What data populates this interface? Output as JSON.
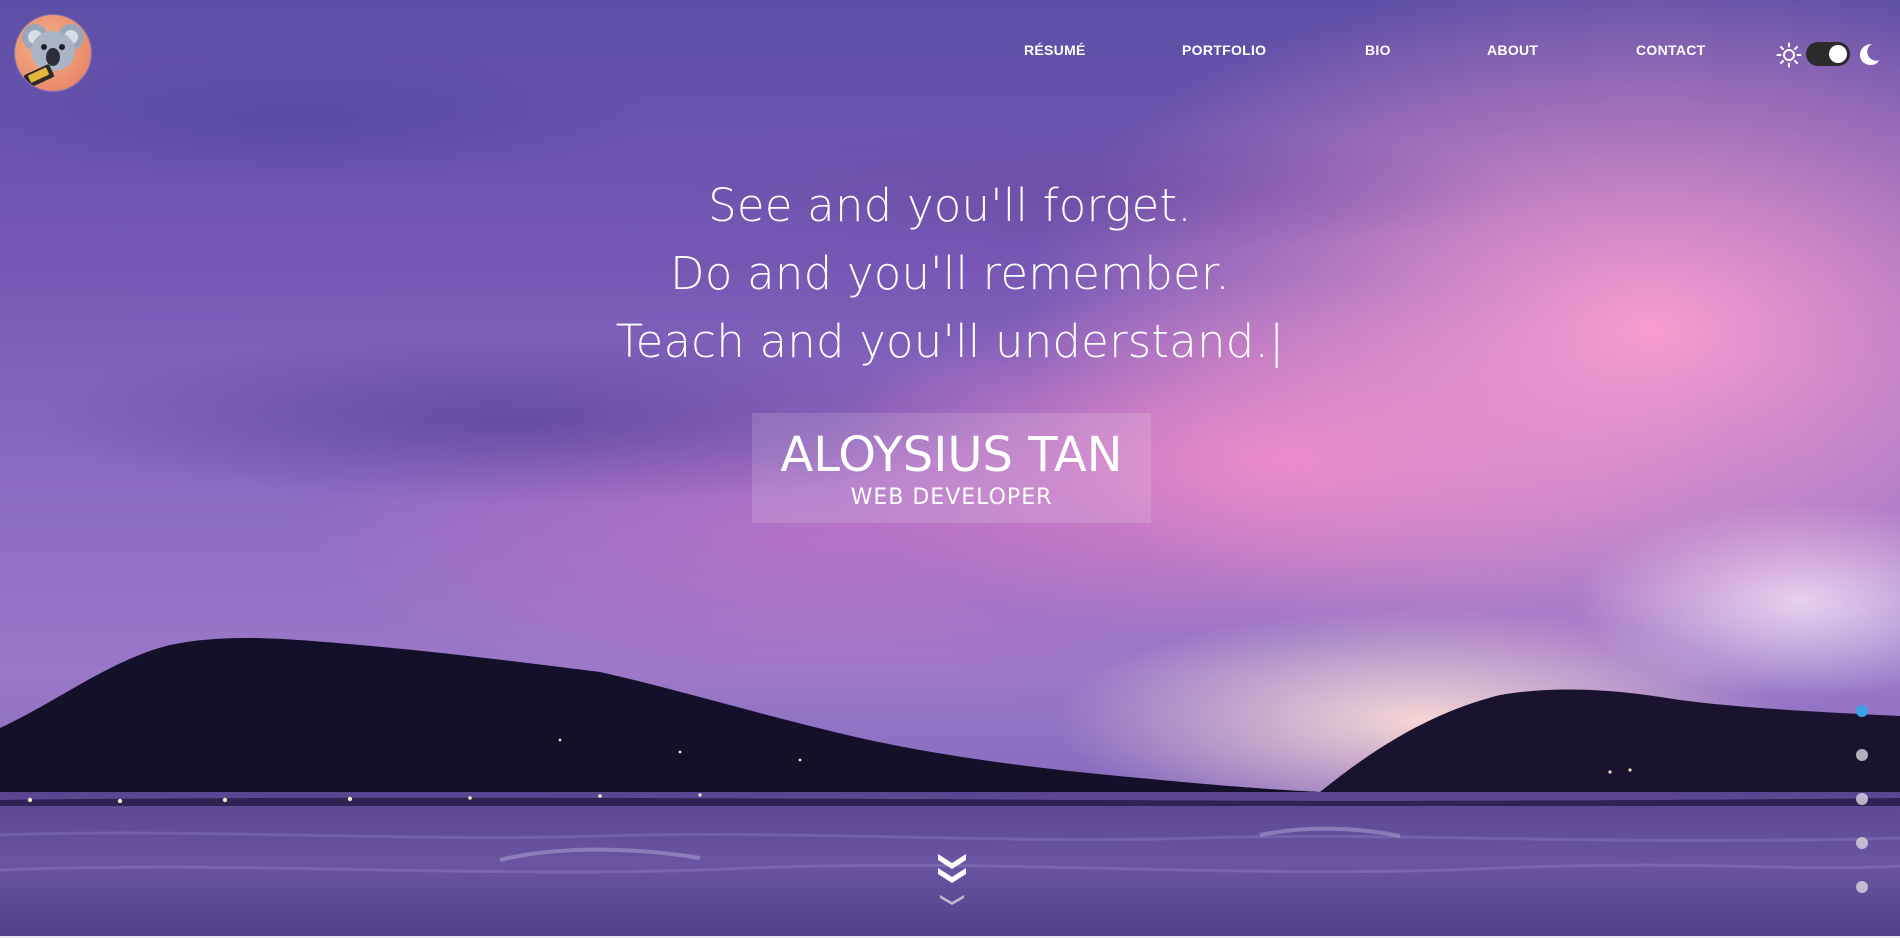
{
  "nav": {
    "items": [
      {
        "label": "RÉSUMÉ"
      },
      {
        "label": "PORTFOLIO"
      },
      {
        "label": "BIO"
      },
      {
        "label": "ABOUT"
      },
      {
        "label": "CONTACT"
      }
    ]
  },
  "theme_toggle": {
    "left_icon": "sun-icon",
    "right_icon": "moon-icon",
    "state": "dark"
  },
  "hero": {
    "quote_lines": [
      "See and you'll forget.",
      "Do and you'll remember.",
      "Teach and you'll understand."
    ],
    "cursor": "|",
    "name": "ALOYSIUS TAN",
    "title": "WEB DEVELOPER"
  },
  "scroll_indicator": {
    "icon": "double-chevron-down-icon"
  },
  "section_pager": {
    "count": 5,
    "active_index": 0
  },
  "colors": {
    "accent": "#3ea0e6",
    "text": "#ffffff",
    "toggle_track": "#2b2b2b"
  },
  "logo": {
    "icon": "koala-avatar-icon"
  }
}
